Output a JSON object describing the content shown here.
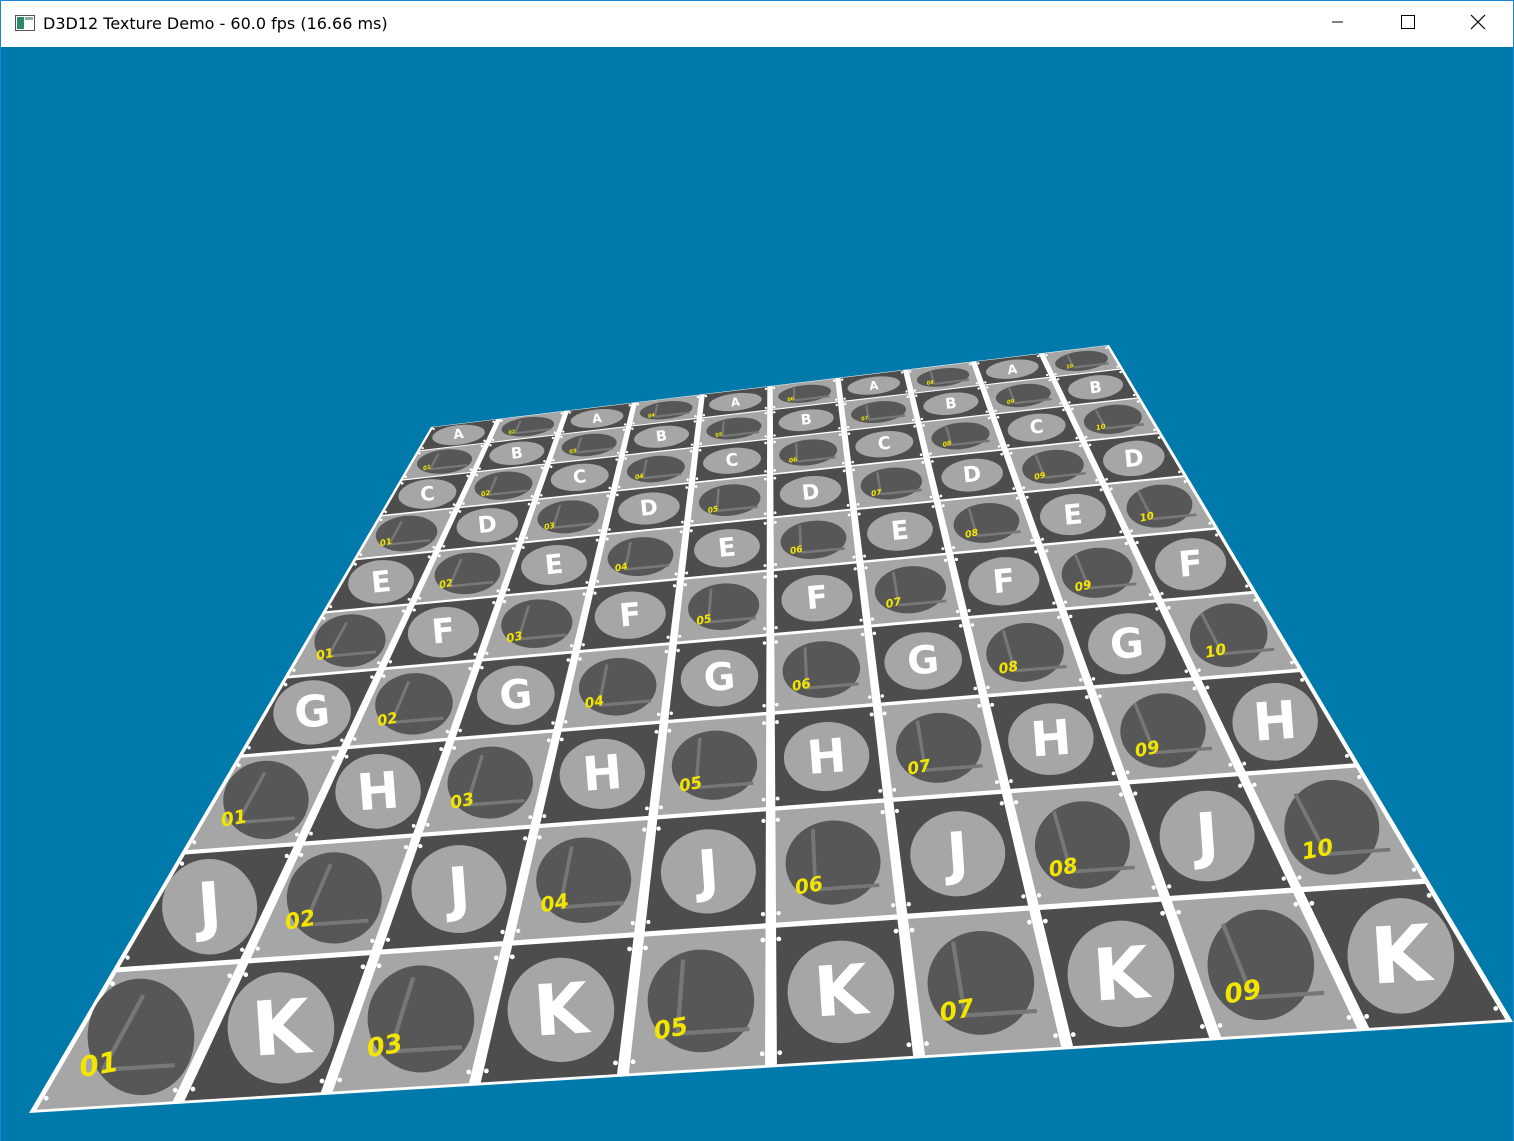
{
  "window": {
    "title": "D3D12 Texture Demo - 60.0 fps (16.66 ms)",
    "icon": "app-window-icon",
    "controls": {
      "minimize_icon": "minimize-icon",
      "maximize_icon": "maximize-icon",
      "close_icon": "close-icon"
    }
  },
  "scene": {
    "background_color": "#007aab",
    "plane_border_color": "#ffffff",
    "tile_colors": {
      "light_square": "#a6a6a6",
      "dark_square": "#4d4d4d",
      "light_circle_fill": "#a6a6a6",
      "dark_circle_fill": "#575757",
      "letter_color": "#ffffff",
      "number_color": "#f2e600",
      "arrow_color": "#777777"
    },
    "grid_rows": 10,
    "grid_cols": 10,
    "letter_rows": [
      "A",
      "B",
      "C",
      "D",
      "E",
      "F",
      "G",
      "H",
      "J",
      "K"
    ],
    "number_cols": [
      "01",
      "02",
      "03",
      "04",
      "05",
      "06",
      "07",
      "08",
      "09",
      "10"
    ]
  }
}
